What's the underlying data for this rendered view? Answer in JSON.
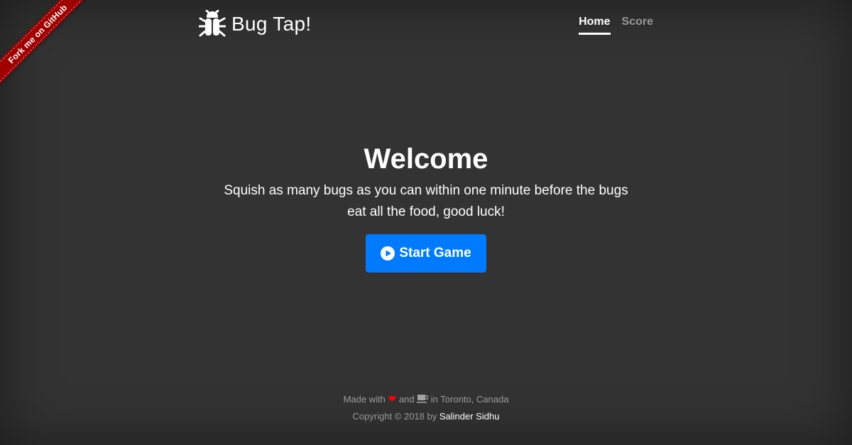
{
  "ribbon": {
    "label": "Fork me on GitHub"
  },
  "header": {
    "brand_title": "Bug Tap!",
    "brand_icon": "bug-icon",
    "nav": [
      {
        "label": "Home",
        "active": true
      },
      {
        "label": "Score",
        "active": false
      }
    ]
  },
  "main": {
    "title": "Welcome",
    "lead": "Squish as many bugs as you can within one minute before the bugs eat all the food, good luck!",
    "start_button": {
      "label": "Start Game",
      "icon": "play-circle-icon"
    }
  },
  "footer": {
    "made_with": "Made with",
    "and": "and",
    "location": "in Toronto, Canada",
    "copyright": "Copyright © 2018 by",
    "author": "Salinder Sidhu",
    "heart_icon": "heart-icon",
    "coffee_icon": "coffee-icon"
  },
  "colors": {
    "background": "#333333",
    "primary_button": "#007bff",
    "ribbon": "#a00000",
    "heart": "#ff0000"
  }
}
